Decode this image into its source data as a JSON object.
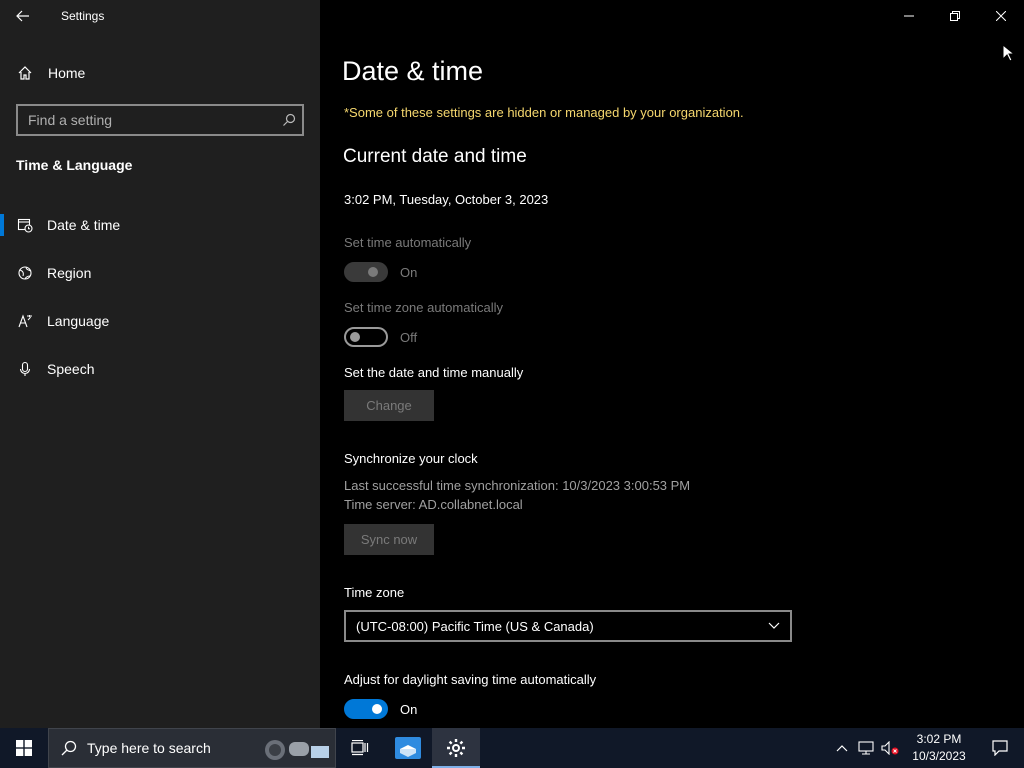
{
  "app": {
    "title": "Settings"
  },
  "sidebar": {
    "home_label": "Home",
    "search_placeholder": "Find a setting",
    "section_title": "Time & Language",
    "items": [
      {
        "label": "Date & time",
        "icon": "clock-calendar-icon",
        "active": true
      },
      {
        "label": "Region",
        "icon": "globe-icon",
        "active": false
      },
      {
        "label": "Language",
        "icon": "language-icon",
        "active": false
      },
      {
        "label": "Speech",
        "icon": "microphone-icon",
        "active": false
      }
    ]
  },
  "main": {
    "page_title": "Date & time",
    "notice": "*Some of these settings are hidden or managed by your organization.",
    "current_section": "Current date and time",
    "current_datetime": "3:02 PM, Tuesday, October 3, 2023",
    "set_time_auto": {
      "label": "Set time automatically",
      "state": "On"
    },
    "set_tz_auto": {
      "label": "Set time zone automatically",
      "state": "Off"
    },
    "manual": {
      "label": "Set the date and time manually",
      "button": "Change"
    },
    "sync": {
      "title": "Synchronize your clock",
      "last_sync": "Last successful time synchronization: 10/3/2023 3:00:53 PM",
      "server": "Time server: AD.collabnet.local",
      "button": "Sync now"
    },
    "timezone": {
      "label": "Time zone",
      "value": "(UTC-08:00) Pacific Time (US & Canada)"
    },
    "dst": {
      "label": "Adjust for daylight saving time automatically",
      "state": "On"
    }
  },
  "taskbar": {
    "search_placeholder": "Type here to search",
    "time": "3:02 PM",
    "date": "10/3/2023"
  },
  "colors": {
    "accent": "#0078d7",
    "notice": "#f5d76e"
  }
}
